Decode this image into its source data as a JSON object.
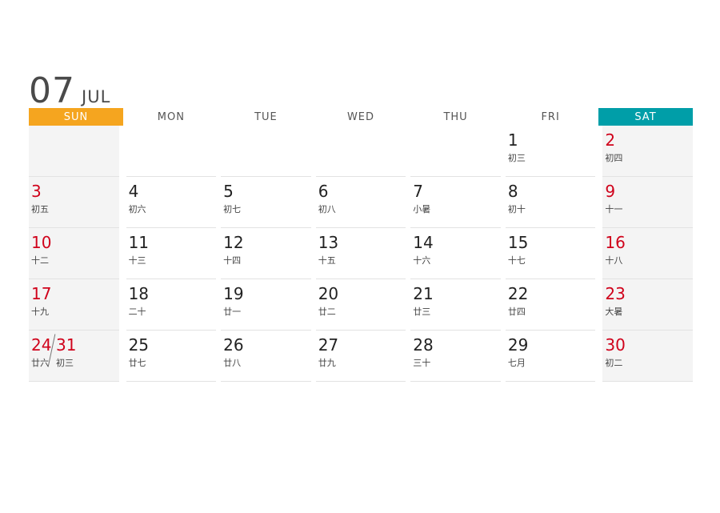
{
  "title": {
    "month_number": "07",
    "month_abbr": "JUL"
  },
  "colors": {
    "sunday_header": "#f5a51f",
    "saturday_header": "#009ea8",
    "weekend_date": "#d0021b"
  },
  "weekdays": [
    "SUN",
    "MON",
    "TUE",
    "WED",
    "THU",
    "FRI",
    "SAT"
  ],
  "weeks": [
    [
      null,
      null,
      null,
      null,
      null,
      {
        "day": "1",
        "lunar": "初三"
      },
      {
        "day": "2",
        "lunar": "初四"
      }
    ],
    [
      {
        "day": "3",
        "lunar": "初五"
      },
      {
        "day": "4",
        "lunar": "初六"
      },
      {
        "day": "5",
        "lunar": "初七"
      },
      {
        "day": "6",
        "lunar": "初八"
      },
      {
        "day": "7",
        "lunar": "小暑"
      },
      {
        "day": "8",
        "lunar": "初十"
      },
      {
        "day": "9",
        "lunar": "十一"
      }
    ],
    [
      {
        "day": "10",
        "lunar": "十二"
      },
      {
        "day": "11",
        "lunar": "十三"
      },
      {
        "day": "12",
        "lunar": "十四"
      },
      {
        "day": "13",
        "lunar": "十五"
      },
      {
        "day": "14",
        "lunar": "十六"
      },
      {
        "day": "15",
        "lunar": "十七"
      },
      {
        "day": "16",
        "lunar": "十八"
      }
    ],
    [
      {
        "day": "17",
        "lunar": "十九"
      },
      {
        "day": "18",
        "lunar": "二十"
      },
      {
        "day": "19",
        "lunar": "廿一"
      },
      {
        "day": "20",
        "lunar": "廿二"
      },
      {
        "day": "21",
        "lunar": "廿三"
      },
      {
        "day": "22",
        "lunar": "廿四"
      },
      {
        "day": "23",
        "lunar": "大暑"
      }
    ],
    [
      {
        "day": "24",
        "day2": "31",
        "lunar": "廿六",
        "lunar2": "初三"
      },
      {
        "day": "25",
        "lunar": "廿七"
      },
      {
        "day": "26",
        "lunar": "廿八"
      },
      {
        "day": "27",
        "lunar": "廿九"
      },
      {
        "day": "28",
        "lunar": "三十"
      },
      {
        "day": "29",
        "lunar": "七月"
      },
      {
        "day": "30",
        "lunar": "初二"
      }
    ]
  ]
}
